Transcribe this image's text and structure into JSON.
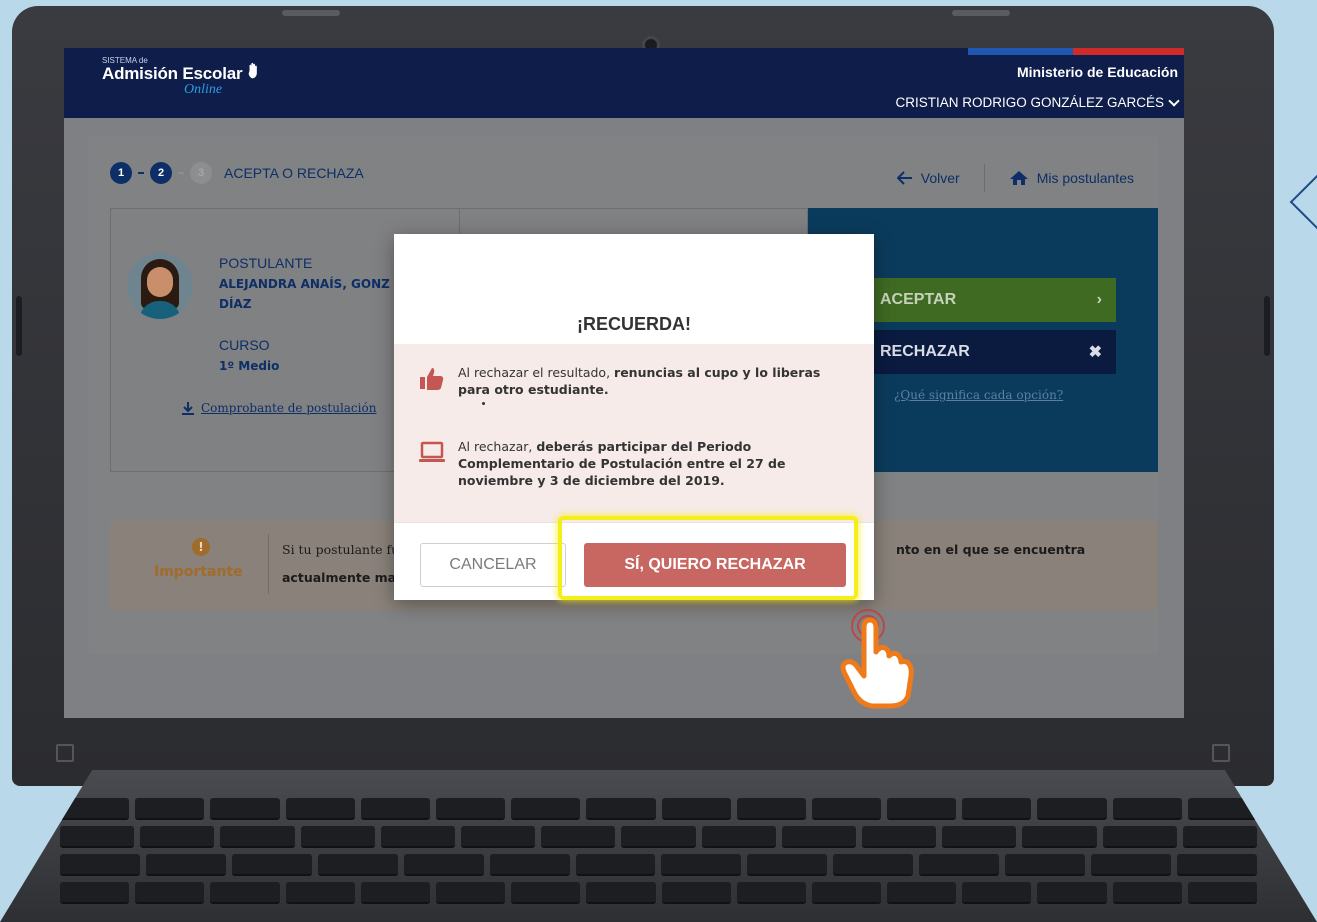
{
  "header": {
    "logo_small": "SISTEMA de",
    "logo_main": "Admisión Escolar",
    "logo_online": "Online",
    "ministry": "Ministerio de Educación",
    "user": "CRISTIAN RODRIGO GONZÁLEZ GARCÉS"
  },
  "steps": {
    "items": [
      "1",
      "2",
      "3"
    ],
    "current_label": "ACEPTA O RECHAZA"
  },
  "nav": {
    "back": "Volver",
    "my_applicants": "Mis postulantes"
  },
  "applicant": {
    "label": "POSTULANTE",
    "name_line1": "ALEJANDRA ANAÍS, GONZ",
    "name_line2": "DÍAZ",
    "course_label": "CURSO",
    "course_value": "1º Medio",
    "receipt_link": "Comprobante de postulación"
  },
  "decision": {
    "accept": "ACEPTAR",
    "reject": "RECHAZAR",
    "meaning_link": "¿Qué significa cada opción?"
  },
  "important": {
    "label": "Importante",
    "text1": "Si tu postulante fu",
    "text2": "actualmente ma",
    "text3": "nto en el que se encuentra"
  },
  "modal": {
    "title": "¡RECUERDA!",
    "item1_pre": "Al rechazar el resultado, ",
    "item1_bold": "renuncias al cupo y lo liberas para otro estudiante.",
    "item2_pre": "Al rechazar, ",
    "item2_bold": "deberás participar del Periodo Complementario de Postulación entre el 27 de noviembre y 3 de diciembre del 2019.",
    "cancel": "CANCELAR",
    "confirm": "SÍ, QUIERO RECHAZAR"
  },
  "colors": {
    "navy": "#0e1d4a",
    "accept_green": "#3f6a22",
    "confirm_red": "#c86762",
    "highlight_yellow": "#f5ee18"
  }
}
